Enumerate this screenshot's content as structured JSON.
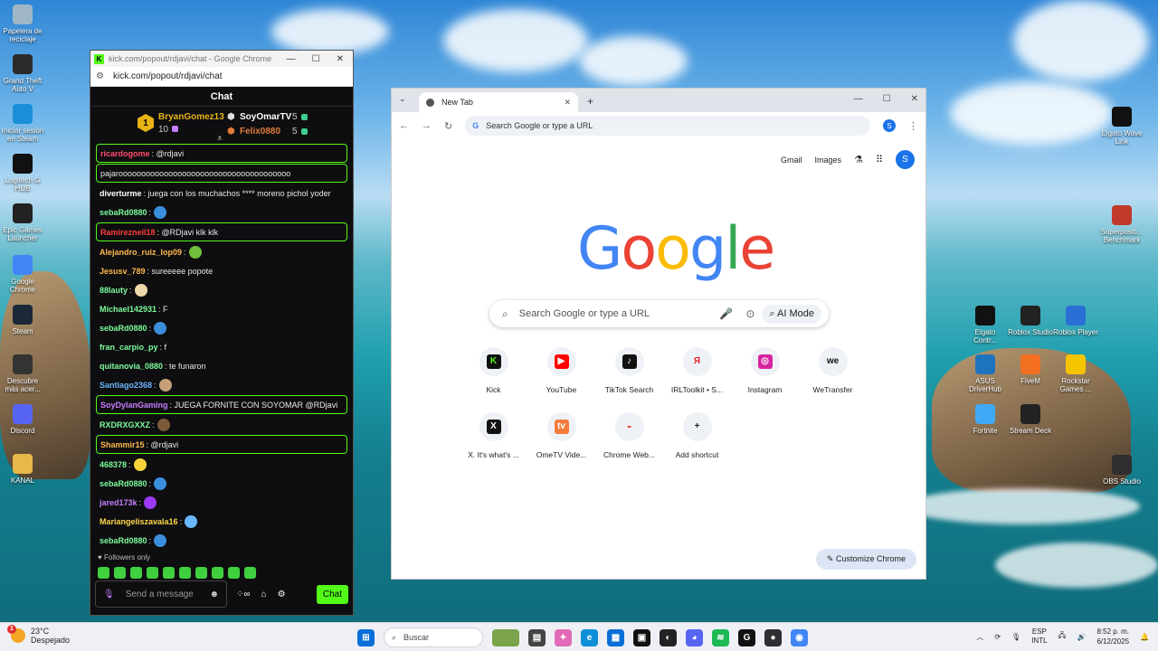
{
  "desktop": {
    "left_icons": [
      {
        "label": "Papelera de reciclaje",
        "icon": "recycle-bin-icon",
        "color": "#9fb6c7"
      },
      {
        "label": "Grand Theft Auto V",
        "icon": "gta-v-icon",
        "color": "#2b2b2b"
      },
      {
        "label": "Iniciar sesión en Steam",
        "icon": "edge-icon",
        "color": "#1a8fd8"
      },
      {
        "label": "Logitech G HUB",
        "icon": "logitech-g-icon",
        "color": "#111111"
      },
      {
        "label": "Epic Games Launcher",
        "icon": "epic-games-icon",
        "color": "#222222"
      },
      {
        "label": "Google Chrome",
        "icon": "chrome-icon",
        "color": "#4285f4"
      },
      {
        "label": "Steam",
        "icon": "steam-icon",
        "color": "#1b2838"
      },
      {
        "label": "Descubre más acer...",
        "icon": "location-icon",
        "color": "#333333"
      },
      {
        "label": "Discord",
        "icon": "discord-icon",
        "color": "#5865f2"
      },
      {
        "label": "KANAL",
        "icon": "folder-icon",
        "color": "#e8b84a"
      }
    ],
    "right_icons": [
      {
        "label": "Elgato Wave Link",
        "icon": "elgato-wave-icon",
        "color": "#111111"
      },
      {
        "label": "Superpositi... Benchmark",
        "icon": "benchmark-icon",
        "color": "#c0392b"
      },
      {
        "label": "Elgato Contr...",
        "icon": "elgato-control-icon",
        "color": "#111111"
      },
      {
        "label": "Roblox Studio",
        "icon": "roblox-studio-icon",
        "color": "#222222"
      },
      {
        "label": "Roblox Player",
        "icon": "roblox-player-icon",
        "color": "#2a6fd6"
      },
      {
        "label": "ASUS DriverHub",
        "icon": "asus-icon",
        "color": "#1e73be"
      },
      {
        "label": "FiveM",
        "icon": "fivem-icon",
        "color": "#f36f21"
      },
      {
        "label": "Rockstar Games ...",
        "icon": "rockstar-icon",
        "color": "#f5c400"
      },
      {
        "label": "Fortnite",
        "icon": "fortnite-icon",
        "color": "#3fa9f5"
      },
      {
        "label": "Stream Deck",
        "icon": "stream-deck-icon",
        "color": "#222222"
      },
      {
        "label": "OBS Studio",
        "icon": "obs-icon",
        "color": "#302e31"
      }
    ]
  },
  "chat_window": {
    "title": "kick.com/popout/rdjavi/chat - Google Chrome",
    "url": "kick.com/popout/rdjavi/chat",
    "header": "Chat",
    "leaderboard": {
      "rank": "1",
      "first": {
        "name": "BryanGomez13",
        "count": "10"
      },
      "second": {
        "name": "SoyOmarTV",
        "count": "5"
      },
      "third": {
        "name": "Felix0880",
        "count": "5"
      }
    },
    "messages": [
      {
        "user": "ricardogome",
        "text": ": @rdjavi",
        "color": "#ff4d6d",
        "hl": true
      },
      {
        "user": "",
        "text": "pajaroooooooooooooooooooooooooooooooooooooo",
        "color": "#ffffff",
        "hl": true
      },
      {
        "user": "diverturme",
        "text": ": juega con los muchachos **** moreno pichol yoder",
        "color": "#ffffff",
        "hl": false
      },
      {
        "user": "sebaRd0880",
        "text": ":",
        "color": "#7dfc9b",
        "hl": false,
        "emote": "#3b8edb"
      },
      {
        "user": "Ramirezneil18",
        "text": ": @RDjavi klk klk",
        "color": "#ff3b3b",
        "hl": true
      },
      {
        "user": "Alejandro_ruiz_lop09",
        "text": ":",
        "color": "#ffb84d",
        "hl": false,
        "emote": "#6fbf3b"
      },
      {
        "user": "Jesusv_789",
        "text": ": sureeeee popote",
        "color": "#ffb84d",
        "hl": false
      },
      {
        "user": "88lauty",
        "text": ":",
        "color": "#7dfc9b",
        "hl": false,
        "emote": "#f0d9a8"
      },
      {
        "user": "Michael142931",
        "text": ": F",
        "color": "#7dfc9b",
        "hl": false
      },
      {
        "user": "sebaRd0880",
        "text": ":",
        "color": "#7dfc9b",
        "hl": false,
        "emote": "#3b8edb"
      },
      {
        "user": "fran_carpio_py",
        "text": ": f",
        "color": "#7dfc9b",
        "hl": false
      },
      {
        "user": "quitanovia_0880",
        "text": ": te funaron",
        "color": "#7dfc9b",
        "hl": false
      },
      {
        "user": "Santiago2368",
        "text": ":",
        "color": "#6ab7ff",
        "hl": false,
        "emote": "#c7a07a"
      },
      {
        "user": "SoyDylanGaming",
        "text": ": JUEGA FORNITE CON SOYOMAR @RDjavi",
        "color": "#c77dff",
        "hl": true
      },
      {
        "user": "RXDRXGXXZ",
        "text": ":",
        "color": "#7dfc9b",
        "hl": false,
        "emote": "#7a5a3b"
      },
      {
        "user": "Shammir15",
        "text": ": @rdjavi",
        "color": "#ffb84d",
        "hl": true
      },
      {
        "user": "468378",
        "text": ":",
        "color": "#7dfc9b",
        "hl": false,
        "emote": "#f5d33b"
      },
      {
        "user": "sebaRd0880",
        "text": ":",
        "color": "#7dfc9b",
        "hl": false,
        "emote": "#3b8edb"
      },
      {
        "user": "jared173k",
        "text": ":",
        "color": "#c77dff",
        "hl": false,
        "emote": "#9b3bf5"
      },
      {
        "user": "Mariangeliszavala16",
        "text": ":",
        "color": "#ffd84d",
        "hl": false,
        "emote": "#6ab7ff"
      },
      {
        "user": "sebaRd0880",
        "text": ":",
        "color": "#7dfc9b",
        "hl": false,
        "emote": "#3b8edb"
      }
    ],
    "followers_only": "Followers only",
    "input_placeholder": "Send a message",
    "send_label": "Chat"
  },
  "chrome": {
    "tab_title": "New Tab",
    "omnibox_placeholder": "Search Google or type a URL",
    "gmail": "Gmail",
    "images": "Images",
    "avatar_letter": "S",
    "logo_letters": [
      {
        "ch": "G",
        "color": "#4285f4"
      },
      {
        "ch": "o",
        "color": "#ea4335"
      },
      {
        "ch": "o",
        "color": "#fbbc05"
      },
      {
        "ch": "g",
        "color": "#4285f4"
      },
      {
        "ch": "l",
        "color": "#34a853"
      },
      {
        "ch": "e",
        "color": "#ea4335"
      }
    ],
    "search_placeholder": "Search Google or type a URL",
    "ai_mode": "AI Mode",
    "shortcuts": [
      {
        "label": "Kick",
        "glyph": "K",
        "bg": "#111",
        "fg": "#53fc18"
      },
      {
        "label": "YouTube",
        "glyph": "▶",
        "bg": "#ff0000",
        "fg": "#fff"
      },
      {
        "label": "TikTok Search",
        "glyph": "♪",
        "bg": "#111",
        "fg": "#fff"
      },
      {
        "label": "IRLToolkit • S...",
        "glyph": "Я",
        "bg": "#eef1f5",
        "fg": "#e0242a"
      },
      {
        "label": "Instagram",
        "glyph": "◎",
        "bg": "#d6249f",
        "fg": "#fff"
      },
      {
        "label": "WeTransfer",
        "glyph": "we",
        "bg": "#eef1f5",
        "fg": "#111"
      },
      {
        "label": "X. It's what's ...",
        "glyph": "X",
        "bg": "#111",
        "fg": "#fff"
      },
      {
        "label": "OmeTV Vide...",
        "glyph": "tv",
        "bg": "#f57c3b",
        "fg": "#fff"
      },
      {
        "label": "Chrome Web...",
        "glyph": "◒",
        "bg": "#eef1f5",
        "fg": "#ea4335"
      },
      {
        "label": "Add shortcut",
        "glyph": "+",
        "bg": "#eef1f5",
        "fg": "#222"
      }
    ],
    "customize": "Customize Chrome"
  },
  "taskbar": {
    "temp": "23°C",
    "weather": "Despejado",
    "weather_badge": "1",
    "search_label": "Buscar",
    "lang_top": "ESP",
    "lang_bottom": "INTL",
    "time": "8:52 p. m.",
    "date": "6/12/2025"
  }
}
